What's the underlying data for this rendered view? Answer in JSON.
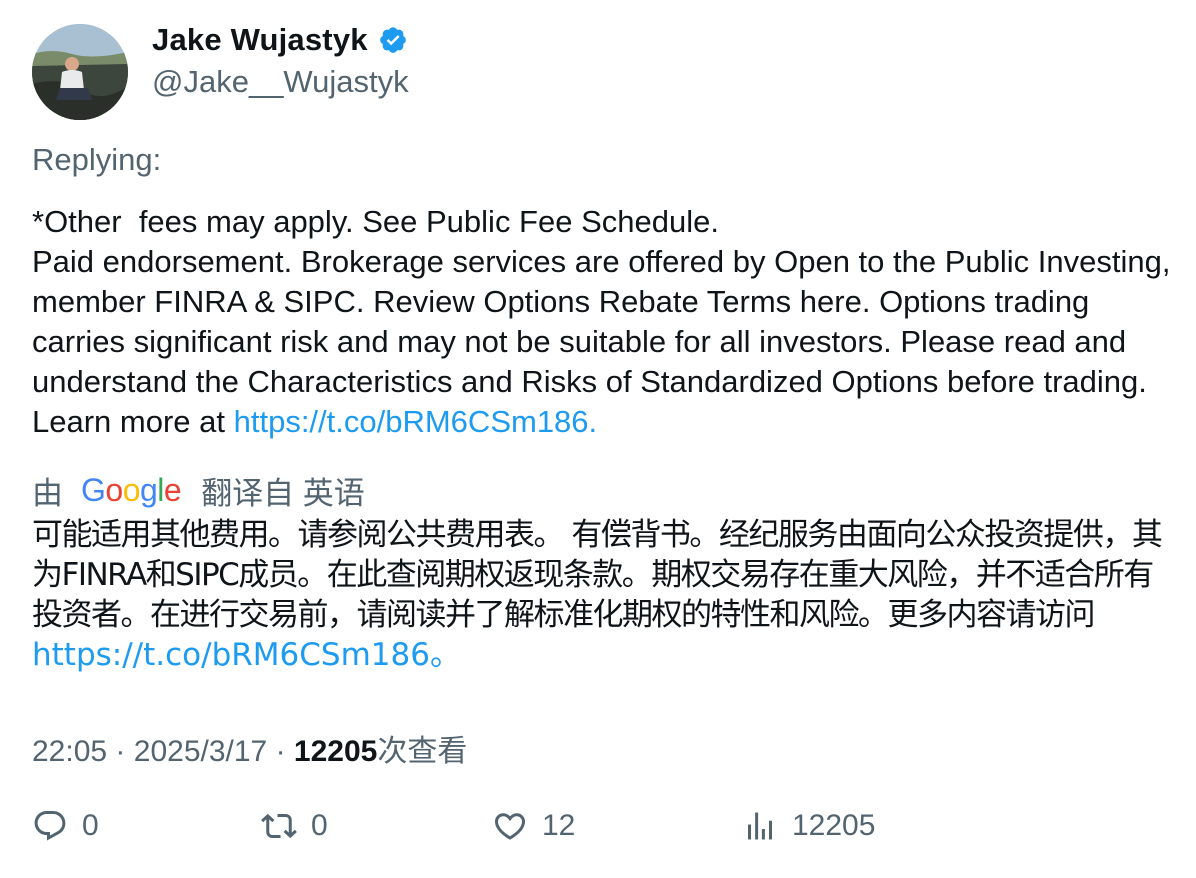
{
  "author": {
    "display_name": "Jake Wujastyk",
    "handle": "@Jake__Wujastyk",
    "verified": true,
    "verified_color": "#1d9bf0"
  },
  "replying_label": "Replying:",
  "tweet": {
    "text": "*Other  fees may apply. See Public Fee Schedule.\nPaid endorsement. Brokerage services are offered by Open to the Public Investing, member FINRA & SIPC. Review Options Rebate Terms here. Options trading carries significant risk and may not be suitable for all investors. Please read and understand the Characteristics and Risks of Standardized Options before trading. Learn more at ",
    "link": "https://t.co/bRM6CSm186."
  },
  "translation": {
    "prefix": "由",
    "provider": "Google",
    "suffix": "翻译自 英语",
    "text": "可能适用其他费用。请参阅公共费用表。 有偿背书。经纪服务由面向公众投资提供，其为FINRA和SIPC成员。在此查阅期权返现条款。期权交易存在重大风险，并不适合所有投资者。在进行交易前，请阅读并了解标准化期权的特性和风险。更多内容请访问",
    "link": "https://t.co/bRM6CSm186。"
  },
  "meta": {
    "time": "22:05",
    "separator": "·",
    "date": "2025/3/17",
    "views_count": "12205",
    "views_label": "次查看"
  },
  "actions": {
    "replies": "0",
    "retweets": "0",
    "likes": "12",
    "views": "12205"
  },
  "colors": {
    "link": "#1d9bf0",
    "secondary_text": "#536471",
    "primary_text": "#0f1419"
  },
  "icons": [
    "verified-badge-icon",
    "reply-icon",
    "retweet-icon",
    "like-icon",
    "views-icon"
  ]
}
